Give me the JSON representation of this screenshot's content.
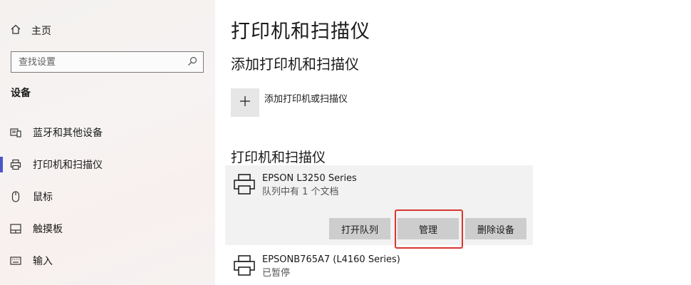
{
  "sidebar": {
    "home_label": "主页",
    "search_placeholder": "查找设置",
    "section_title": "设备",
    "items": [
      {
        "label": "蓝牙和其他设备",
        "icon": "bluetooth-devices-icon"
      },
      {
        "label": "打印机和扫描仪",
        "icon": "printer-icon",
        "active": true
      },
      {
        "label": "鼠标",
        "icon": "mouse-icon"
      },
      {
        "label": "触摸板",
        "icon": "touchpad-icon"
      },
      {
        "label": "输入",
        "icon": "keyboard-icon"
      }
    ]
  },
  "main": {
    "page_title": "打印机和扫描仪",
    "add_section_title": "添加打印机和扫描仪",
    "add_label": "添加打印机或扫描仪",
    "list_title": "打印机和扫描仪",
    "printers": [
      {
        "name": "EPSON L3250 Series",
        "status": "队列中有 1 个文档",
        "buttons": {
          "open_queue": "打开队列",
          "manage": "管理",
          "remove": "删除设备"
        }
      },
      {
        "name": "EPSONB765A7 (L4160 Series)",
        "status": "已暂停"
      }
    ]
  },
  "colors": {
    "active_indicator": "#4a55c7",
    "highlight": "#d8372f",
    "button_bg": "#cdcdcd",
    "expanded_bg": "#f2f2f2"
  }
}
